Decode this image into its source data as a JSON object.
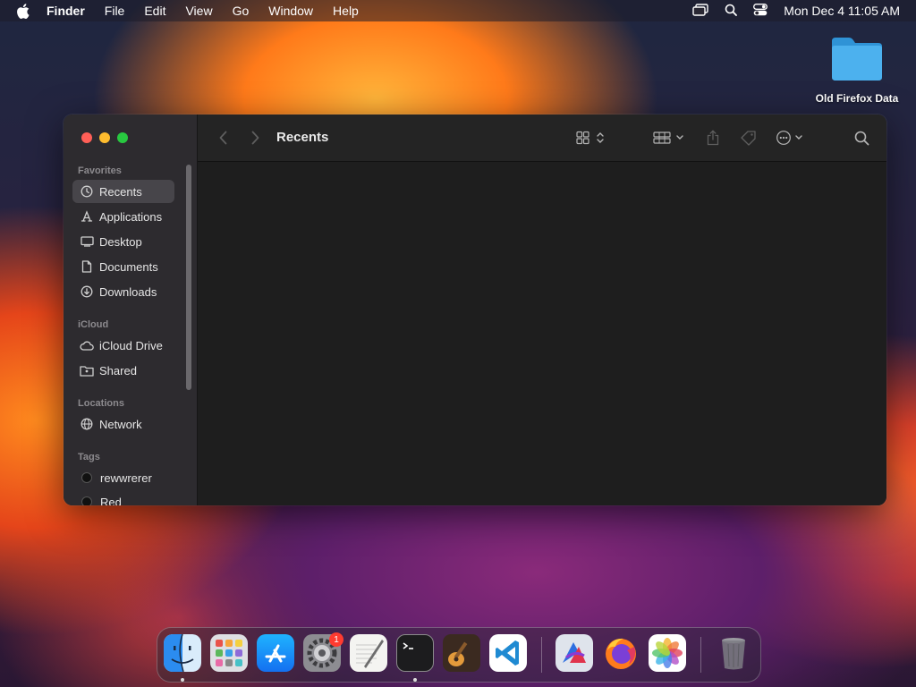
{
  "menubar": {
    "app_name": "Finder",
    "items": [
      "File",
      "Edit",
      "View",
      "Go",
      "Window",
      "Help"
    ],
    "clock": "Mon Dec 4  11:05 AM"
  },
  "desktop": {
    "folder_label": "Old Firefox Data"
  },
  "finder": {
    "title": "Recents",
    "sections": {
      "favorites": "Favorites",
      "icloud": "iCloud",
      "locations": "Locations",
      "tags": "Tags"
    },
    "favorites": [
      "Recents",
      "Applications",
      "Desktop",
      "Documents",
      "Downloads"
    ],
    "icloud": [
      "iCloud Drive",
      "Shared"
    ],
    "locations": [
      "Network"
    ],
    "tags": [
      "rewwrerer",
      "Red"
    ]
  },
  "dock": {
    "apps": [
      "Finder",
      "Launchpad",
      "App Store",
      "System Settings",
      "TextEdit",
      "Terminal",
      "GarageBand",
      "Visual Studio Code",
      "Affinity",
      "Firefox",
      "Photos",
      "Trash"
    ],
    "settings_badge": "1"
  },
  "colors": {
    "accent": "#0a84ff",
    "window_bg": "#1e1e1e",
    "sidebar_bg": "#2d2b2f"
  }
}
